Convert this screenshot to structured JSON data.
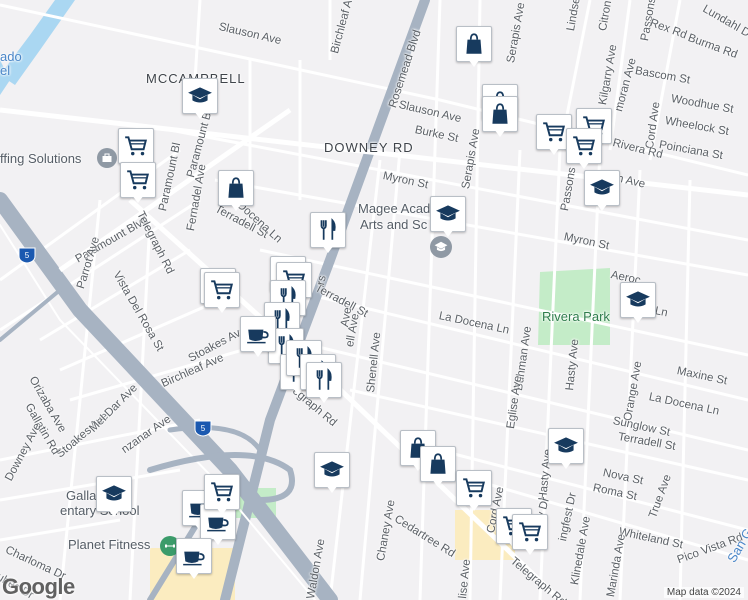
{
  "streets": {
    "slauson_1": "Slauson Ave",
    "slauson_2": "Slauson Ave",
    "slauson_3": "on Ave",
    "birchleaf_n": "Birchleaf Ave",
    "rosemead": "Rosemead Blvd",
    "mccampbell": "MCCAMPBELL",
    "downey_rd": "DOWNEY RD",
    "burke": "Burke St",
    "myron_1": "Myron St",
    "myron_2": "Myron St",
    "serapis_1": "Serapis Ave",
    "serapis_2": "Serapis Ave",
    "paramount_blvd": "Paramount Blvd",
    "paramount_bl": "Paramount Bl",
    "telegraph_1": "Telegraph Rd",
    "telegraph_2": "Telegraph Rd",
    "telegraph_3": "egraph Rd",
    "fernadel": "Fernadel Ave",
    "terradell_1": "Terradell St",
    "terradell_2": "Terradell St",
    "terradell_3": "Terradell St",
    "docena_1": "Docena Ln",
    "docena_2": "La Docena Ln",
    "docena_3": "La Docena Ln",
    "parrot": "Parrot Ave",
    "vista_del_rosa": "Vista Del Rosa St",
    "birchleaf_s": "Birchleaf Ave",
    "stoakes_1": "Stoakes Ave",
    "stoakes_2": "Stoakes Ave",
    "orizaba": "Orizaba Ave",
    "gallatin": "Gallatin Rd",
    "mel_dar": "Mel Dar Ave",
    "manzanar": "nzanar Ave",
    "downey_ave": "Downey Ave",
    "shenell": "Shenell Ave",
    "ell_ave": "ell Ave",
    "rs_frag": "rs",
    "ave_frag": "Ave",
    "buhman": "Buhman Ave",
    "eglise_1": "Eglise Ave",
    "eglise_2": "Eglise Ave",
    "hasty_1": "Hasty Ave",
    "hasty_2": "Hasty Ave",
    "orange": "Orange Ave",
    "maxine": "Maxine St",
    "sunglow": "Sunglow St",
    "nova": "Nova St",
    "roma": "Roma St",
    "true": "True Ave",
    "whiteland": "Whiteland St",
    "pico_vista": "Pico Vista Rd",
    "klinedale": "Klinedale Ave",
    "marinda": "Marinda Ave",
    "ringfest": "ingfest Dr",
    "view_dr": "View Dr",
    "cord_1": "Cord Ave",
    "cord_2": "Cord Ave",
    "chaney": "Chaney Ave",
    "cedartree": "Cedartree Rd",
    "waldon": "Waldon Ave",
    "charloma": "Charloma Dr",
    "subec": "ubec Dr",
    "lise": "lise Ave",
    "passons_1": "Passons Blvd",
    "passons_2": "Passons Blvd",
    "kilgarry": "Kilgarry Ave",
    "lindsey": "Lindsey Ave",
    "citron": "Citron",
    "lundahl": "Lundahl D",
    "rex": "Rex Rd",
    "burma": "Burma Rd",
    "bascom": "Bascom St",
    "woodhue": "Woodhue St",
    "wheelock": "Wheelock St",
    "poinciana": "Poinciana St",
    "rivera_rd": "Rivera Rd",
    "moran": "moran Ave",
    "aeroc": "Aeroc",
    "ln_frag": "Ln",
    "san_frag": "San G",
    "ado": "ado",
    "el": "el",
    "lse": "Lse"
  },
  "places": {
    "magee_1": "Magee Acad",
    "magee_2": "Arts and Sc",
    "rivera_park": "Rivera Park",
    "staffing": "ffing Solutions",
    "planet_fitness": "Planet Fitness",
    "gallatin_1": "Gallatin",
    "gallatin_2": "entary School"
  },
  "highway": {
    "i5_north": "5",
    "i5_south": "5"
  },
  "attribution": "Map data ©2024",
  "logo": "Google",
  "markers": [
    {
      "type": "shopping-bag"
    },
    {
      "type": "shopping-bag"
    },
    {
      "type": "shopping-bag"
    },
    {
      "type": "shopping-cart"
    },
    {
      "type": "shopping-cart"
    },
    {
      "type": "shopping-cart"
    },
    {
      "type": "shopping-cart"
    },
    {
      "type": "school"
    },
    {
      "type": "school"
    },
    {
      "type": "shopping-cart"
    },
    {
      "type": "shopping-cart"
    },
    {
      "type": "shopping-cart"
    },
    {
      "type": "school"
    },
    {
      "type": "shopping-bag"
    },
    {
      "type": "restaurant"
    },
    {
      "type": "school"
    },
    {
      "type": "shopping-cart"
    },
    {
      "type": "shopping-cart"
    },
    {
      "type": "restaurant"
    },
    {
      "type": "restaurant"
    },
    {
      "type": "restaurant"
    },
    {
      "type": "cafe"
    },
    {
      "type": "restaurant"
    },
    {
      "type": "restaurant"
    },
    {
      "type": "restaurant"
    },
    {
      "type": "restaurant"
    },
    {
      "type": "school"
    },
    {
      "type": "school"
    },
    {
      "type": "shopping-bag"
    },
    {
      "type": "shopping-bag"
    },
    {
      "type": "shopping-cart"
    },
    {
      "type": "school"
    },
    {
      "type": "shopping-cart"
    },
    {
      "type": "shopping-cart"
    },
    {
      "type": "cafe"
    },
    {
      "type": "cafe"
    },
    {
      "type": "cafe"
    },
    {
      "type": "shopping-cart"
    }
  ],
  "colors": {
    "school_blue": "#173a5e",
    "park_green": "#c4ecc8",
    "highway": "#a7b3c2",
    "water": "#aad7f2"
  }
}
